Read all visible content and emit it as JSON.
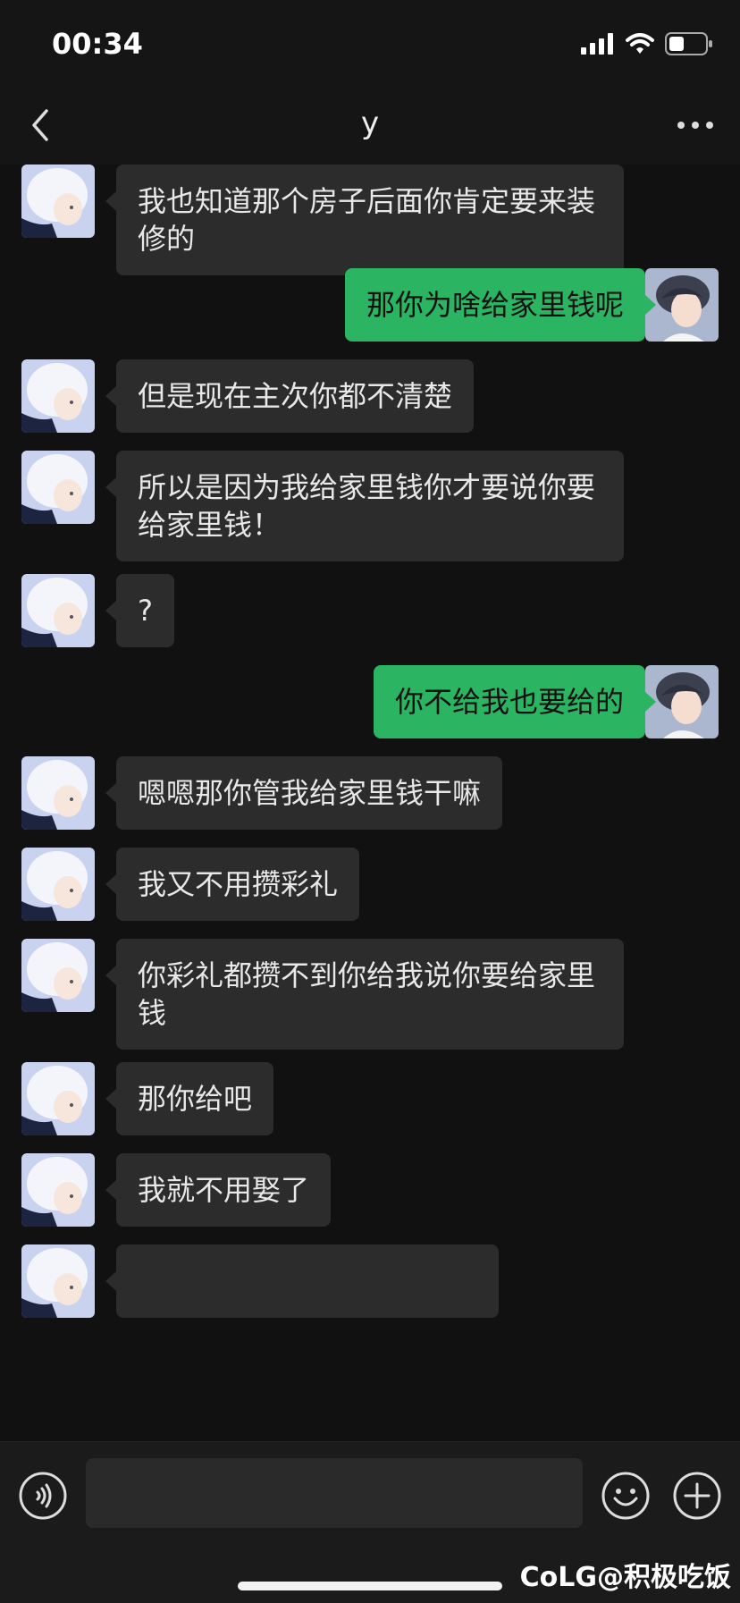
{
  "status_bar": {
    "time": "00:34"
  },
  "header": {
    "title": "y"
  },
  "messages": [
    {
      "side": "left",
      "text": "我也知道那个房子后面你肯定要来装修的"
    },
    {
      "side": "right",
      "text": "那你为啥给家里钱呢"
    },
    {
      "side": "left",
      "text": "但是现在主次你都不清楚"
    },
    {
      "side": "left",
      "text": "所以是因为我给家里钱你才要说你要给家里钱！"
    },
    {
      "side": "left",
      "text": "?"
    },
    {
      "side": "right",
      "text": "你不给我也要给的"
    },
    {
      "side": "left",
      "text": "嗯嗯那你管我给家里钱干嘛"
    },
    {
      "side": "left",
      "text": "我又不用攒彩礼"
    },
    {
      "side": "left",
      "text": "你彩礼都攒不到你给我说你要给家里钱"
    },
    {
      "side": "left",
      "text": "那你给吧"
    },
    {
      "side": "left",
      "text": "我就不用娶了"
    },
    {
      "side": "left",
      "text": ""
    }
  ],
  "icons": {
    "back": "chevron-left-icon",
    "more": "more-icon",
    "voice": "voice-icon",
    "emoji": "emoji-icon",
    "plus": "plus-icon"
  },
  "colors": {
    "background": "#111111",
    "bubble_incoming": "#2c2c2c",
    "bubble_outgoing": "#2bb462"
  },
  "watermark": "CoLG@积极吃饭"
}
